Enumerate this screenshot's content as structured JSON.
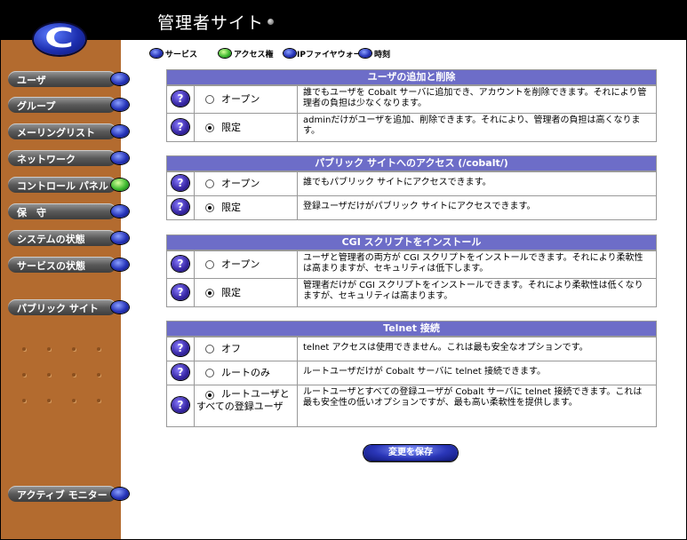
{
  "header": {
    "title": "管理者サイト"
  },
  "sidebar": {
    "items": [
      {
        "label": "ユーザ",
        "active": false
      },
      {
        "label": "グループ",
        "active": false
      },
      {
        "label": "メーリングリスト",
        "active": false
      },
      {
        "label": "ネットワーク",
        "active": false
      },
      {
        "label": "コントロール パネル",
        "active": true
      },
      {
        "label": "保　守",
        "active": false
      },
      {
        "label": "システムの状態",
        "active": false
      },
      {
        "label": "サービスの状態",
        "active": false
      },
      {
        "label": "パブリック サイト",
        "active": false
      },
      {
        "label": "アクティブ モニター",
        "active": false
      }
    ]
  },
  "tabs": [
    {
      "label": "サービス",
      "active": false
    },
    {
      "label": "アクセス権",
      "active": true
    },
    {
      "label": "IPファイヤウォール",
      "active": false
    },
    {
      "label": "時刻",
      "active": false
    }
  ],
  "sections": [
    {
      "title": "ユーザの追加と削除",
      "options": [
        {
          "label": "オープン",
          "checked": false,
          "description": "誰でもユーザを Cobalt サーバに追加でき、アカウントを削除できます。それにより管理者の負担は少なくなります。"
        },
        {
          "label": "限定",
          "checked": true,
          "description": "adminだけがユーザを追加、削除できます。それにより、管理者の負担は高くなります。"
        }
      ]
    },
    {
      "title": "パブリック サイトへのアクセス (/cobalt/)",
      "options": [
        {
          "label": "オープン",
          "checked": false,
          "description": "誰でもパブリック サイトにアクセスできます。"
        },
        {
          "label": "限定",
          "checked": true,
          "description": "登録ユーザだけがパブリック サイトにアクセスできます。"
        }
      ]
    },
    {
      "title": "CGI スクリプトをインストール",
      "options": [
        {
          "label": "オープン",
          "checked": false,
          "description": "ユーザと管理者の両方が CGI スクリプトをインストールできます。それにより柔軟性は高まりますが、セキュリティは低下します。"
        },
        {
          "label": "限定",
          "checked": true,
          "description": "管理者だけが CGI スクリプトをインストールできます。それにより柔軟性は低くなりますが、セキュリティは高まります。"
        }
      ]
    },
    {
      "title": "Telnet 接続",
      "options": [
        {
          "label": "オフ",
          "checked": false,
          "description": "telnet アクセスは使用できません。これは最も安全なオプションです。"
        },
        {
          "label": "ルートのみ",
          "checked": false,
          "description": "ルートユーザだけが Cobalt サーバに telnet 接続できます。"
        },
        {
          "label": "ルートユーザとすべての登録ユーザ",
          "checked": true,
          "description": "ルートユーザとすべての登録ユーザが Cobalt サーバに telnet 接続できます。これは最も安全性の低いオプションですが、最も高い柔軟性を提供します。"
        }
      ]
    }
  ],
  "save_label": "変更を保存",
  "help_glyph": "?",
  "icons": {
    "help": "help-icon",
    "logo": "cobalt-logo-icon"
  }
}
